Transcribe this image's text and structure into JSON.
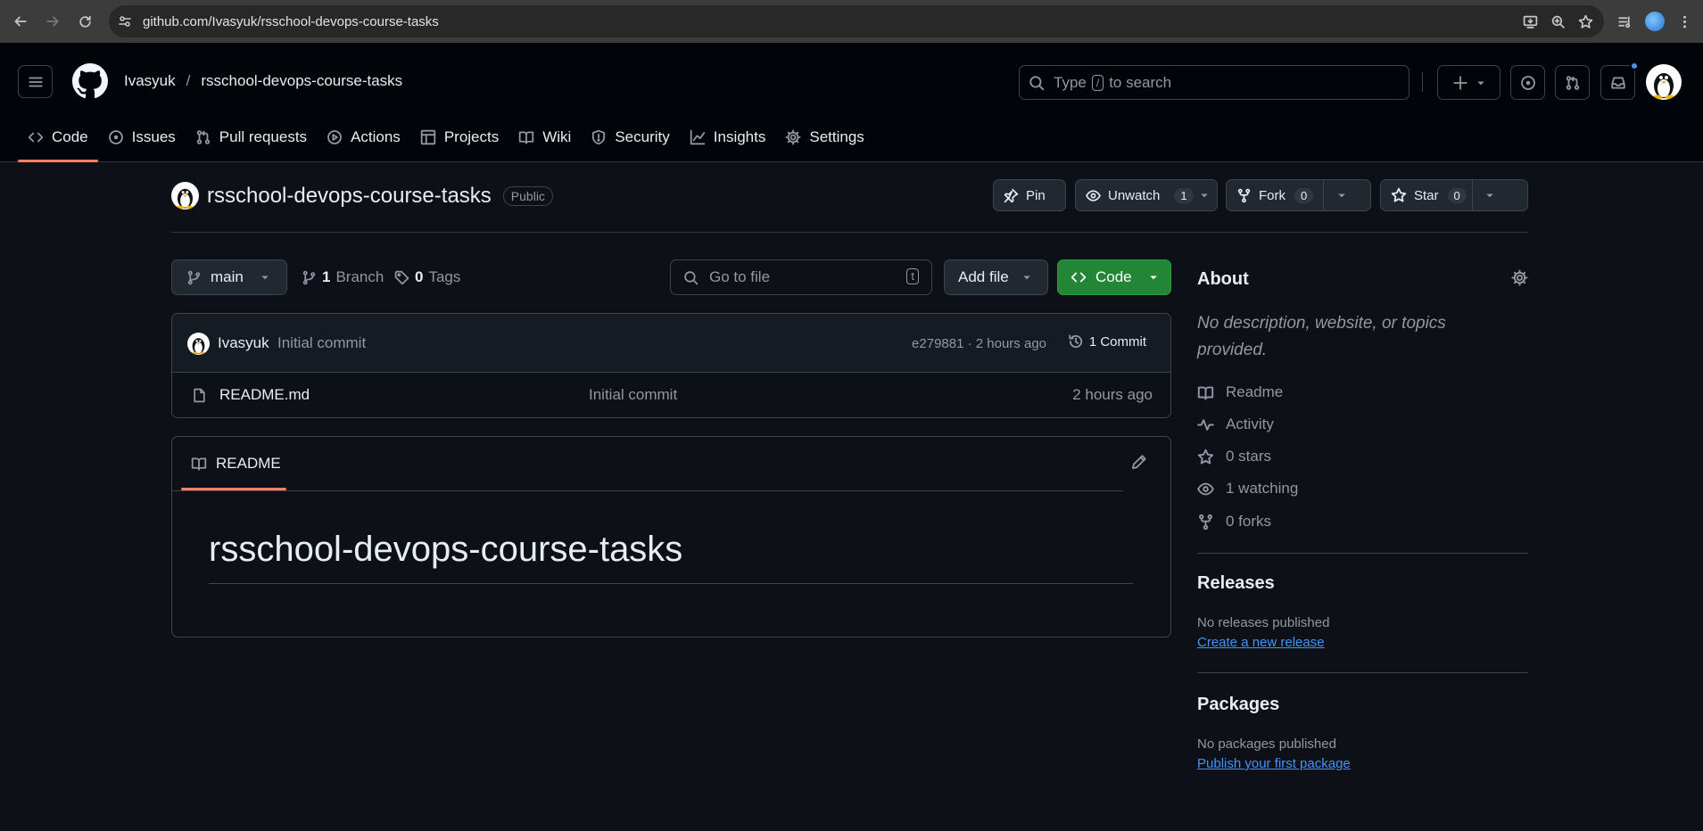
{
  "browser": {
    "url": "github.com/Ivasyuk/rsschool-devops-course-tasks"
  },
  "header": {
    "owner": "Ivasyuk",
    "separator": "/",
    "repo": "rsschool-devops-course-tasks",
    "search_prefix": "Type",
    "search_key": "/",
    "search_suffix": "to search"
  },
  "repo_nav": [
    {
      "label": "Code",
      "icon": "code-icon"
    },
    {
      "label": "Issues",
      "icon": "issue-icon"
    },
    {
      "label": "Pull requests",
      "icon": "pull-request-icon"
    },
    {
      "label": "Actions",
      "icon": "play-icon"
    },
    {
      "label": "Projects",
      "icon": "table-icon"
    },
    {
      "label": "Wiki",
      "icon": "book-icon"
    },
    {
      "label": "Security",
      "icon": "shield-icon"
    },
    {
      "label": "Insights",
      "icon": "graph-icon"
    },
    {
      "label": "Settings",
      "icon": "gear-icon"
    }
  ],
  "repo": {
    "name": "rsschool-devops-course-tasks",
    "visibility": "Public",
    "pin_label": "Pin",
    "watch_label": "Unwatch",
    "watch_count": "1",
    "fork_label": "Fork",
    "fork_count": "0",
    "star_label": "Star",
    "star_count": "0"
  },
  "file_nav": {
    "branch": "main",
    "branch_count": "1",
    "branch_label": "Branch",
    "tag_count": "0",
    "tag_label": "Tags",
    "goto_placeholder": "Go to file",
    "goto_key": "t",
    "add_file_label": "Add file",
    "code_label": "Code"
  },
  "latest_commit": {
    "author": "Ivasyuk",
    "message": "Initial commit",
    "hash_time": "e279881 · 2 hours ago",
    "commit_count": "1 Commit"
  },
  "files": [
    {
      "name": "README.md",
      "message": "Initial commit",
      "time": "2 hours ago"
    }
  ],
  "readme": {
    "tab_label": "README",
    "heading": "rsschool-devops-course-tasks"
  },
  "about": {
    "title": "About",
    "description": "No description, website, or topics provided.",
    "items": [
      {
        "label": "Readme",
        "icon": "book-icon"
      },
      {
        "label": "Activity",
        "icon": "pulse-icon"
      },
      {
        "label": "0 stars",
        "icon": "star-icon"
      },
      {
        "label": "1 watching",
        "icon": "eye-icon"
      },
      {
        "label": "0 forks",
        "icon": "fork-icon"
      }
    ]
  },
  "releases": {
    "title": "Releases",
    "note": "No releases published",
    "link": "Create a new release"
  },
  "packages": {
    "title": "Packages",
    "note": "No packages published",
    "link": "Publish your first package"
  },
  "colors": {
    "background": "#0d1117",
    "header_bg": "#010409",
    "accent_underline": "#f78166",
    "code_button": "#238636",
    "link": "#4493f8"
  }
}
